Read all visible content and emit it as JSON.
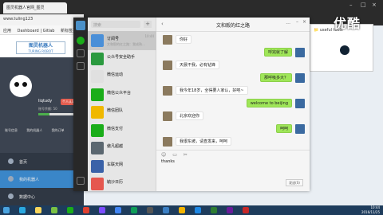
{
  "browser": {
    "tab_title": "图灵机器人官网_图灵",
    "url": "www.tuling123",
    "bookmarks": [
      "应用",
      "Dashboard | Gitlab",
      "新标签页"
    ],
    "extension_folder": "useful tools"
  },
  "site": {
    "logo_cn": "图灵机器人",
    "logo_en": "TURING ROBOT",
    "username": "liqtudy",
    "badge": "个人认证",
    "info": "账号余额: 50",
    "progress": 0.3,
    "menu": [
      "账号信息",
      "我的机器人",
      "我的订单"
    ],
    "nav": [
      "首页",
      "我的机器人",
      "数据中心"
    ]
  },
  "watermark": "优酷",
  "wechat": {
    "search_placeholder": "搜索",
    "contacts": [
      {
        "name": "订阅号",
        "sub": "文和毅的红之路：我成熟…",
        "time": "10:44",
        "color": "#4a8fd8",
        "active": true
      },
      {
        "name": "公众号安全助手",
        "sub": "",
        "time": "",
        "color": "#2b9a3f",
        "active": false
      },
      {
        "name": "微信运动",
        "sub": "",
        "time": "",
        "color": "#e0e0e0",
        "active": false
      },
      {
        "name": "微信公众平台",
        "sub": "",
        "time": "",
        "color": "#1aad19",
        "active": false
      },
      {
        "name": "微信团队",
        "sub": "",
        "time": "",
        "color": "#f0b800",
        "active": false
      },
      {
        "name": "微信支付",
        "sub": "",
        "time": "",
        "color": "#1aad19",
        "active": false
      },
      {
        "name": "傲凡超越",
        "sub": "",
        "time": "",
        "color": "#5b6770",
        "active": false
      },
      {
        "name": "车联天网",
        "sub": "",
        "time": "",
        "color": "#3a62a8",
        "active": false
      },
      {
        "name": "毓沙日历",
        "sub": "",
        "time": "",
        "color": "#e5574e",
        "active": false
      }
    ],
    "chat_title": "文和毅的红之路",
    "messages": [
      {
        "side": "l",
        "text": "你好"
      },
      {
        "side": "r",
        "text": "呼完就了解"
      },
      {
        "side": "l",
        "text": "天晨不我，必有钻锋"
      },
      {
        "side": "r",
        "text": "那呼吸多大？"
      },
      {
        "side": "l",
        "text": "我今年18岁，全得要人家认，好吧~"
      },
      {
        "side": "r",
        "text": "welcome to beijing"
      },
      {
        "side": "l",
        "text": "北京欢迎你"
      },
      {
        "side": "r",
        "text": "呵呵"
      },
      {
        "side": "l",
        "text": "我很东坡，请查发来，呵呵"
      }
    ],
    "input_text": "thanks",
    "send_label": "发送(S)"
  },
  "taskbar": {
    "time": "10:44",
    "date": "2016/11/25",
    "icons": [
      "#4aa3df",
      "#2aa8e0",
      "#f9d65c",
      "#7ac143",
      "#1aad19",
      "#e0402f",
      "#7c4dff",
      "#4285f4",
      "#0f9d58",
      "#555555",
      "#3b7fc4",
      "#f4b400",
      "#1e88e5",
      "#2e7d32",
      "#6a1b9a",
      "#c62828"
    ]
  }
}
